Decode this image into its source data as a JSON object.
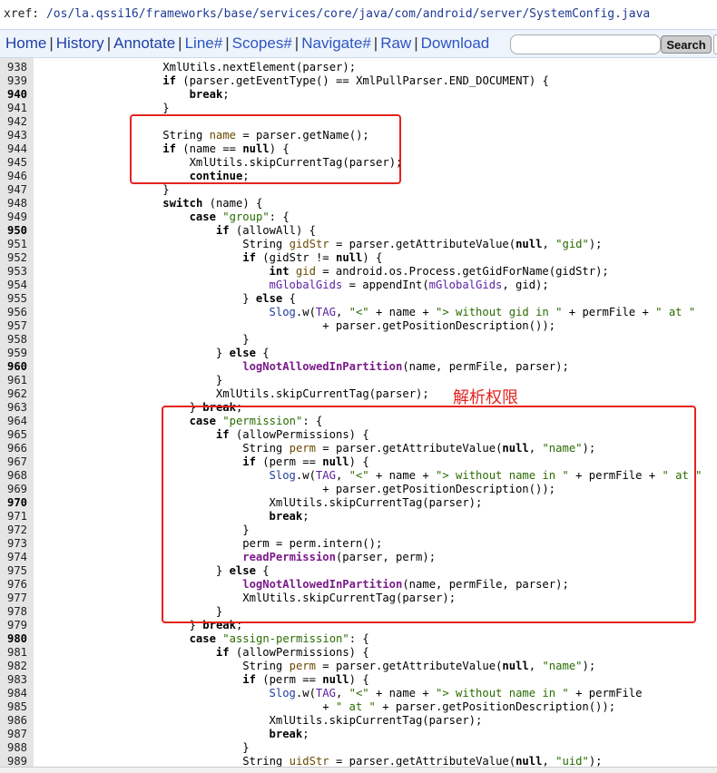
{
  "xref": {
    "prefix": "xref: ",
    "path": "/os/la.qssi16/frameworks/base/services/core/java/com/android/server/SystemConfig.java"
  },
  "nav": {
    "items": [
      "Home",
      "History",
      "Annotate",
      "Line#",
      "Scopes#",
      "Navigate#",
      "Raw",
      "Download"
    ],
    "search_placeholder": "",
    "search_button": "Search"
  },
  "annotation": "解析权限",
  "colors": {
    "highlight_border": "#e5231e",
    "link": "#2d55c2",
    "string": "#2a6b00"
  },
  "code": [
    {
      "num": "938",
      "bold": false,
      "indent": 16,
      "segs": [
        [
          "p",
          "XmlUtils.nextElement(parser);"
        ]
      ]
    },
    {
      "num": "939",
      "bold": false,
      "indent": 16,
      "segs": [
        [
          "k",
          "if"
        ],
        [
          "p",
          " (parser.getEventType() == XmlPullParser.END_DOCUMENT) {"
        ]
      ]
    },
    {
      "num": "940",
      "bold": true,
      "indent": 20,
      "segs": [
        [
          "k",
          "break"
        ],
        [
          "p",
          ";"
        ]
      ]
    },
    {
      "num": "941",
      "bold": false,
      "indent": 16,
      "segs": [
        [
          "p",
          "}"
        ]
      ]
    },
    {
      "num": "942",
      "bold": false,
      "indent": 0,
      "segs": []
    },
    {
      "num": "943",
      "bold": false,
      "indent": 16,
      "segs": [
        [
          "p",
          "String "
        ],
        [
          "v",
          "name"
        ],
        [
          "p",
          " = parser.getName();"
        ]
      ]
    },
    {
      "num": "944",
      "bold": false,
      "indent": 16,
      "segs": [
        [
          "k",
          "if"
        ],
        [
          "p",
          " (name == "
        ],
        [
          "k",
          "null"
        ],
        [
          "p",
          ") {"
        ]
      ]
    },
    {
      "num": "945",
      "bold": false,
      "indent": 20,
      "segs": [
        [
          "p",
          "XmlUtils.skipCurrentTag(parser);"
        ]
      ]
    },
    {
      "num": "946",
      "bold": false,
      "indent": 20,
      "segs": [
        [
          "k",
          "continue"
        ],
        [
          "p",
          ";"
        ]
      ]
    },
    {
      "num": "947",
      "bold": false,
      "indent": 16,
      "segs": [
        [
          "p",
          "}"
        ]
      ]
    },
    {
      "num": "948",
      "bold": false,
      "indent": 16,
      "segs": [
        [
          "k",
          "switch"
        ],
        [
          "p",
          " (name) {"
        ]
      ]
    },
    {
      "num": "949",
      "bold": false,
      "indent": 20,
      "segs": [
        [
          "k",
          "case"
        ],
        [
          "p",
          " "
        ],
        [
          "s",
          "\"group\""
        ],
        [
          "p",
          ": {"
        ]
      ]
    },
    {
      "num": "950",
      "bold": true,
      "indent": 24,
      "segs": [
        [
          "k",
          "if"
        ],
        [
          "p",
          " (allowAll) {"
        ]
      ]
    },
    {
      "num": "951",
      "bold": false,
      "indent": 28,
      "segs": [
        [
          "p",
          "String "
        ],
        [
          "v",
          "gidStr"
        ],
        [
          "p",
          " = parser.getAttributeValue("
        ],
        [
          "k",
          "null"
        ],
        [
          "p",
          ", "
        ],
        [
          "s",
          "\"gid\""
        ],
        [
          "p",
          ");"
        ]
      ]
    },
    {
      "num": "952",
      "bold": false,
      "indent": 28,
      "segs": [
        [
          "k",
          "if"
        ],
        [
          "p",
          " (gidStr != "
        ],
        [
          "k",
          "null"
        ],
        [
          "p",
          ") {"
        ]
      ]
    },
    {
      "num": "953",
      "bold": false,
      "indent": 32,
      "segs": [
        [
          "k",
          "int"
        ],
        [
          "p",
          " "
        ],
        [
          "v",
          "gid"
        ],
        [
          "p",
          " = android.os.Process.getGidForName(gidStr);"
        ]
      ]
    },
    {
      "num": "954",
      "bold": false,
      "indent": 32,
      "segs": [
        [
          "n",
          "mGlobalGids"
        ],
        [
          "p",
          " = appendInt("
        ],
        [
          "n",
          "mGlobalGids"
        ],
        [
          "p",
          ", gid);"
        ]
      ]
    },
    {
      "num": "955",
      "bold": false,
      "indent": 28,
      "segs": [
        [
          "p",
          "} "
        ],
        [
          "k",
          "else"
        ],
        [
          "p",
          " {"
        ]
      ]
    },
    {
      "num": "956",
      "bold": false,
      "indent": 32,
      "segs": [
        [
          "l",
          "Slog"
        ],
        [
          "p",
          ".w("
        ],
        [
          "n",
          "TAG"
        ],
        [
          "p",
          ", "
        ],
        [
          "s",
          "\"<\""
        ],
        [
          "p",
          " + name + "
        ],
        [
          "s",
          "\"> without gid in \""
        ],
        [
          "p",
          " + permFile + "
        ],
        [
          "s",
          "\" at \""
        ]
      ]
    },
    {
      "num": "957",
      "bold": false,
      "indent": 40,
      "segs": [
        [
          "p",
          "+ parser.getPositionDescription());"
        ]
      ]
    },
    {
      "num": "958",
      "bold": false,
      "indent": 28,
      "segs": [
        [
          "p",
          "}"
        ]
      ]
    },
    {
      "num": "959",
      "bold": false,
      "indent": 24,
      "segs": [
        [
          "p",
          "} "
        ],
        [
          "k",
          "else"
        ],
        [
          "p",
          " {"
        ]
      ]
    },
    {
      "num": "960",
      "bold": true,
      "indent": 28,
      "segs": [
        [
          "f",
          "logNotAllowedInPartition"
        ],
        [
          "p",
          "(name, permFile, parser);"
        ]
      ]
    },
    {
      "num": "961",
      "bold": false,
      "indent": 24,
      "segs": [
        [
          "p",
          "}"
        ]
      ]
    },
    {
      "num": "962",
      "bold": false,
      "indent": 24,
      "segs": [
        [
          "p",
          "XmlUtils.skipCurrentTag(parser);"
        ]
      ]
    },
    {
      "num": "963",
      "bold": false,
      "indent": 20,
      "segs": [
        [
          "p",
          "} "
        ],
        [
          "k",
          "break"
        ],
        [
          "p",
          ";"
        ]
      ]
    },
    {
      "num": "964",
      "bold": false,
      "indent": 20,
      "segs": [
        [
          "k",
          "case"
        ],
        [
          "p",
          " "
        ],
        [
          "s",
          "\"permission\""
        ],
        [
          "p",
          ": {"
        ]
      ]
    },
    {
      "num": "965",
      "bold": false,
      "indent": 24,
      "segs": [
        [
          "k",
          "if"
        ],
        [
          "p",
          " (allowPermissions) {"
        ]
      ]
    },
    {
      "num": "966",
      "bold": false,
      "indent": 28,
      "segs": [
        [
          "p",
          "String "
        ],
        [
          "v",
          "perm"
        ],
        [
          "p",
          " = parser.getAttributeValue("
        ],
        [
          "k",
          "null"
        ],
        [
          "p",
          ", "
        ],
        [
          "s",
          "\"name\""
        ],
        [
          "p",
          ");"
        ]
      ]
    },
    {
      "num": "967",
      "bold": false,
      "indent": 28,
      "segs": [
        [
          "k",
          "if"
        ],
        [
          "p",
          " (perm == "
        ],
        [
          "k",
          "null"
        ],
        [
          "p",
          ") {"
        ]
      ]
    },
    {
      "num": "968",
      "bold": false,
      "indent": 32,
      "segs": [
        [
          "l",
          "Slog"
        ],
        [
          "p",
          ".w("
        ],
        [
          "n",
          "TAG"
        ],
        [
          "p",
          ", "
        ],
        [
          "s",
          "\"<\""
        ],
        [
          "p",
          " + name + "
        ],
        [
          "s",
          "\"> without name in \""
        ],
        [
          "p",
          " + permFile + "
        ],
        [
          "s",
          "\" at \""
        ]
      ]
    },
    {
      "num": "969",
      "bold": false,
      "indent": 40,
      "segs": [
        [
          "p",
          "+ parser.getPositionDescription());"
        ]
      ]
    },
    {
      "num": "970",
      "bold": true,
      "indent": 32,
      "segs": [
        [
          "p",
          "XmlUtils.skipCurrentTag(parser);"
        ]
      ]
    },
    {
      "num": "971",
      "bold": false,
      "indent": 32,
      "segs": [
        [
          "k",
          "break"
        ],
        [
          "p",
          ";"
        ]
      ]
    },
    {
      "num": "972",
      "bold": false,
      "indent": 28,
      "segs": [
        [
          "p",
          "}"
        ]
      ]
    },
    {
      "num": "973",
      "bold": false,
      "indent": 28,
      "segs": [
        [
          "p",
          "perm = perm.intern();"
        ]
      ]
    },
    {
      "num": "974",
      "bold": false,
      "indent": 28,
      "segs": [
        [
          "f",
          "readPermission"
        ],
        [
          "p",
          "(parser, perm);"
        ]
      ]
    },
    {
      "num": "975",
      "bold": false,
      "indent": 24,
      "segs": [
        [
          "p",
          "} "
        ],
        [
          "k",
          "else"
        ],
        [
          "p",
          " {"
        ]
      ]
    },
    {
      "num": "976",
      "bold": false,
      "indent": 28,
      "segs": [
        [
          "f",
          "logNotAllowedInPartition"
        ],
        [
          "p",
          "(name, permFile, parser);"
        ]
      ]
    },
    {
      "num": "977",
      "bold": false,
      "indent": 28,
      "segs": [
        [
          "p",
          "XmlUtils.skipCurrentTag(parser);"
        ]
      ]
    },
    {
      "num": "978",
      "bold": false,
      "indent": 24,
      "segs": [
        [
          "p",
          "}"
        ]
      ]
    },
    {
      "num": "979",
      "bold": false,
      "indent": 20,
      "segs": [
        [
          "p",
          "} "
        ],
        [
          "k",
          "break"
        ],
        [
          "p",
          ";"
        ]
      ]
    },
    {
      "num": "980",
      "bold": true,
      "indent": 20,
      "segs": [
        [
          "k",
          "case"
        ],
        [
          "p",
          " "
        ],
        [
          "s",
          "\"assign-permission\""
        ],
        [
          "p",
          ": {"
        ]
      ]
    },
    {
      "num": "981",
      "bold": false,
      "indent": 24,
      "segs": [
        [
          "k",
          "if"
        ],
        [
          "p",
          " (allowPermissions) {"
        ]
      ]
    },
    {
      "num": "982",
      "bold": false,
      "indent": 28,
      "segs": [
        [
          "p",
          "String "
        ],
        [
          "v",
          "perm"
        ],
        [
          "p",
          " = parser.getAttributeValue("
        ],
        [
          "k",
          "null"
        ],
        [
          "p",
          ", "
        ],
        [
          "s",
          "\"name\""
        ],
        [
          "p",
          ");"
        ]
      ]
    },
    {
      "num": "983",
      "bold": false,
      "indent": 28,
      "segs": [
        [
          "k",
          "if"
        ],
        [
          "p",
          " (perm == "
        ],
        [
          "k",
          "null"
        ],
        [
          "p",
          ") {"
        ]
      ]
    },
    {
      "num": "984",
      "bold": false,
      "indent": 32,
      "segs": [
        [
          "l",
          "Slog"
        ],
        [
          "p",
          ".w("
        ],
        [
          "n",
          "TAG"
        ],
        [
          "p",
          ", "
        ],
        [
          "s",
          "\"<\""
        ],
        [
          "p",
          " + name + "
        ],
        [
          "s",
          "\"> without name in \""
        ],
        [
          "p",
          " + permFile"
        ]
      ]
    },
    {
      "num": "985",
      "bold": false,
      "indent": 40,
      "segs": [
        [
          "p",
          "+ "
        ],
        [
          "s",
          "\" at \""
        ],
        [
          "p",
          " + parser.getPositionDescription());"
        ]
      ]
    },
    {
      "num": "986",
      "bold": false,
      "indent": 32,
      "segs": [
        [
          "p",
          "XmlUtils.skipCurrentTag(parser);"
        ]
      ]
    },
    {
      "num": "987",
      "bold": false,
      "indent": 32,
      "segs": [
        [
          "k",
          "break"
        ],
        [
          "p",
          ";"
        ]
      ]
    },
    {
      "num": "988",
      "bold": false,
      "indent": 28,
      "segs": [
        [
          "p",
          "}"
        ]
      ]
    },
    {
      "num": "989",
      "bold": false,
      "indent": 28,
      "segs": [
        [
          "p",
          "String "
        ],
        [
          "v",
          "uidStr"
        ],
        [
          "p",
          " = parser.getAttributeValue("
        ],
        [
          "k",
          "null"
        ],
        [
          "p",
          ", "
        ],
        [
          "s",
          "\"uid\""
        ],
        [
          "p",
          ");"
        ]
      ]
    }
  ]
}
